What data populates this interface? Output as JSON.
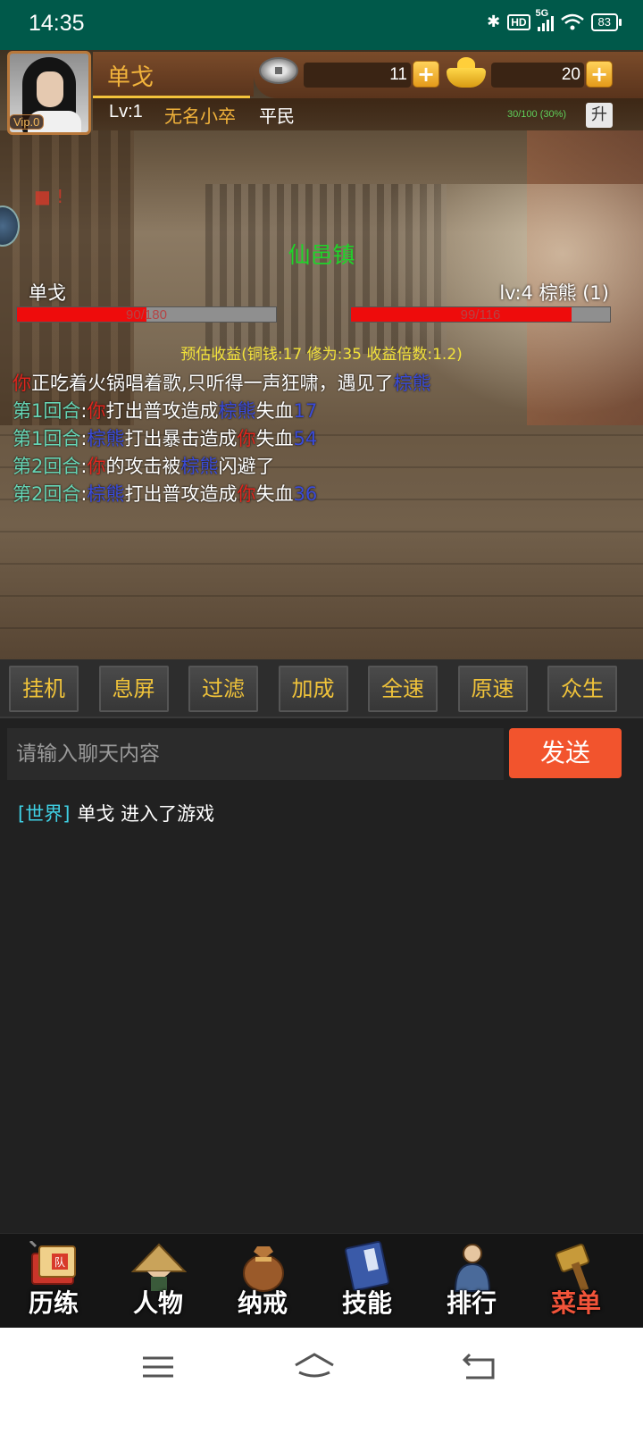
{
  "status_bar": {
    "time": "14:35",
    "network": "5G",
    "hd": "HD",
    "battery": "83"
  },
  "player": {
    "name": "单戈",
    "vip": "Vip.0",
    "level": "Lv:1",
    "title": "无名小卒",
    "rank": "平民",
    "exp_text": "30/100 (30%)",
    "upgrade_label": "升",
    "copper": "11",
    "gold": "20",
    "plus_label": "+"
  },
  "battle": {
    "location": "仙邑镇",
    "player_name": "单戈",
    "player_hp_text": "90/180",
    "player_hp_fraction": 0.5,
    "enemy_name": "lv:4 棕熊 (1)",
    "enemy_hp_text": "99/116",
    "enemy_hp_fraction": 0.853,
    "gain_text": "预估收益(铜钱:17 修为:35 收益倍数:1.2)",
    "log": [
      [
        {
          "t": "你",
          "c": "r"
        },
        {
          "t": "正吃着火锅唱着歌,只听得一声狂啸，遇见了",
          "c": "w"
        },
        {
          "t": "棕熊",
          "c": "b"
        }
      ],
      [
        {
          "t": "第1回合",
          "c": "g"
        },
        {
          "t": ":",
          "c": "w"
        },
        {
          "t": "你",
          "c": "r"
        },
        {
          "t": "打出普攻造成",
          "c": "w"
        },
        {
          "t": "棕熊",
          "c": "b"
        },
        {
          "t": "失血",
          "c": "w"
        },
        {
          "t": "17",
          "c": "n"
        }
      ],
      [
        {
          "t": "第1回合",
          "c": "g"
        },
        {
          "t": ":",
          "c": "w"
        },
        {
          "t": "棕熊",
          "c": "b"
        },
        {
          "t": "打出暴击造成",
          "c": "w"
        },
        {
          "t": "你",
          "c": "r"
        },
        {
          "t": "失血",
          "c": "w"
        },
        {
          "t": "54",
          "c": "n"
        }
      ],
      [
        {
          "t": "第2回合",
          "c": "g"
        },
        {
          "t": ":",
          "c": "w"
        },
        {
          "t": "你",
          "c": "r"
        },
        {
          "t": "的攻击被",
          "c": "w"
        },
        {
          "t": "棕熊",
          "c": "b"
        },
        {
          "t": "闪避了",
          "c": "w"
        }
      ],
      [
        {
          "t": "第2回合",
          "c": "g"
        },
        {
          "t": ":",
          "c": "w"
        },
        {
          "t": "棕熊",
          "c": "b"
        },
        {
          "t": "打出普攻造成",
          "c": "w"
        },
        {
          "t": "你",
          "c": "r"
        },
        {
          "t": "失血",
          "c": "w"
        },
        {
          "t": "36",
          "c": "n"
        }
      ]
    ]
  },
  "controls": [
    "挂机",
    "息屏",
    "过滤",
    "加成",
    "全速",
    "原速",
    "众生"
  ],
  "chat": {
    "placeholder": "请输入聊天内容",
    "send_label": "发送",
    "messages": [
      {
        "channel": "[世界]",
        "text": "单戈 进入了游戏"
      }
    ]
  },
  "bottom_nav": [
    {
      "label": "历练",
      "icon": "training-scroll-icon",
      "badge": "队"
    },
    {
      "label": "人物",
      "icon": "character-hat-icon"
    },
    {
      "label": "纳戒",
      "icon": "storage-bag-icon"
    },
    {
      "label": "技能",
      "icon": "skill-book-icon"
    },
    {
      "label": "排行",
      "icon": "ranking-figure-icon"
    },
    {
      "label": "菜单",
      "icon": "menu-hammer-icon"
    }
  ],
  "colors": {
    "accent": "#f0c33a",
    "send": "#f2542d",
    "hp": "#ee0c0c",
    "status_bar": "#00594a"
  }
}
